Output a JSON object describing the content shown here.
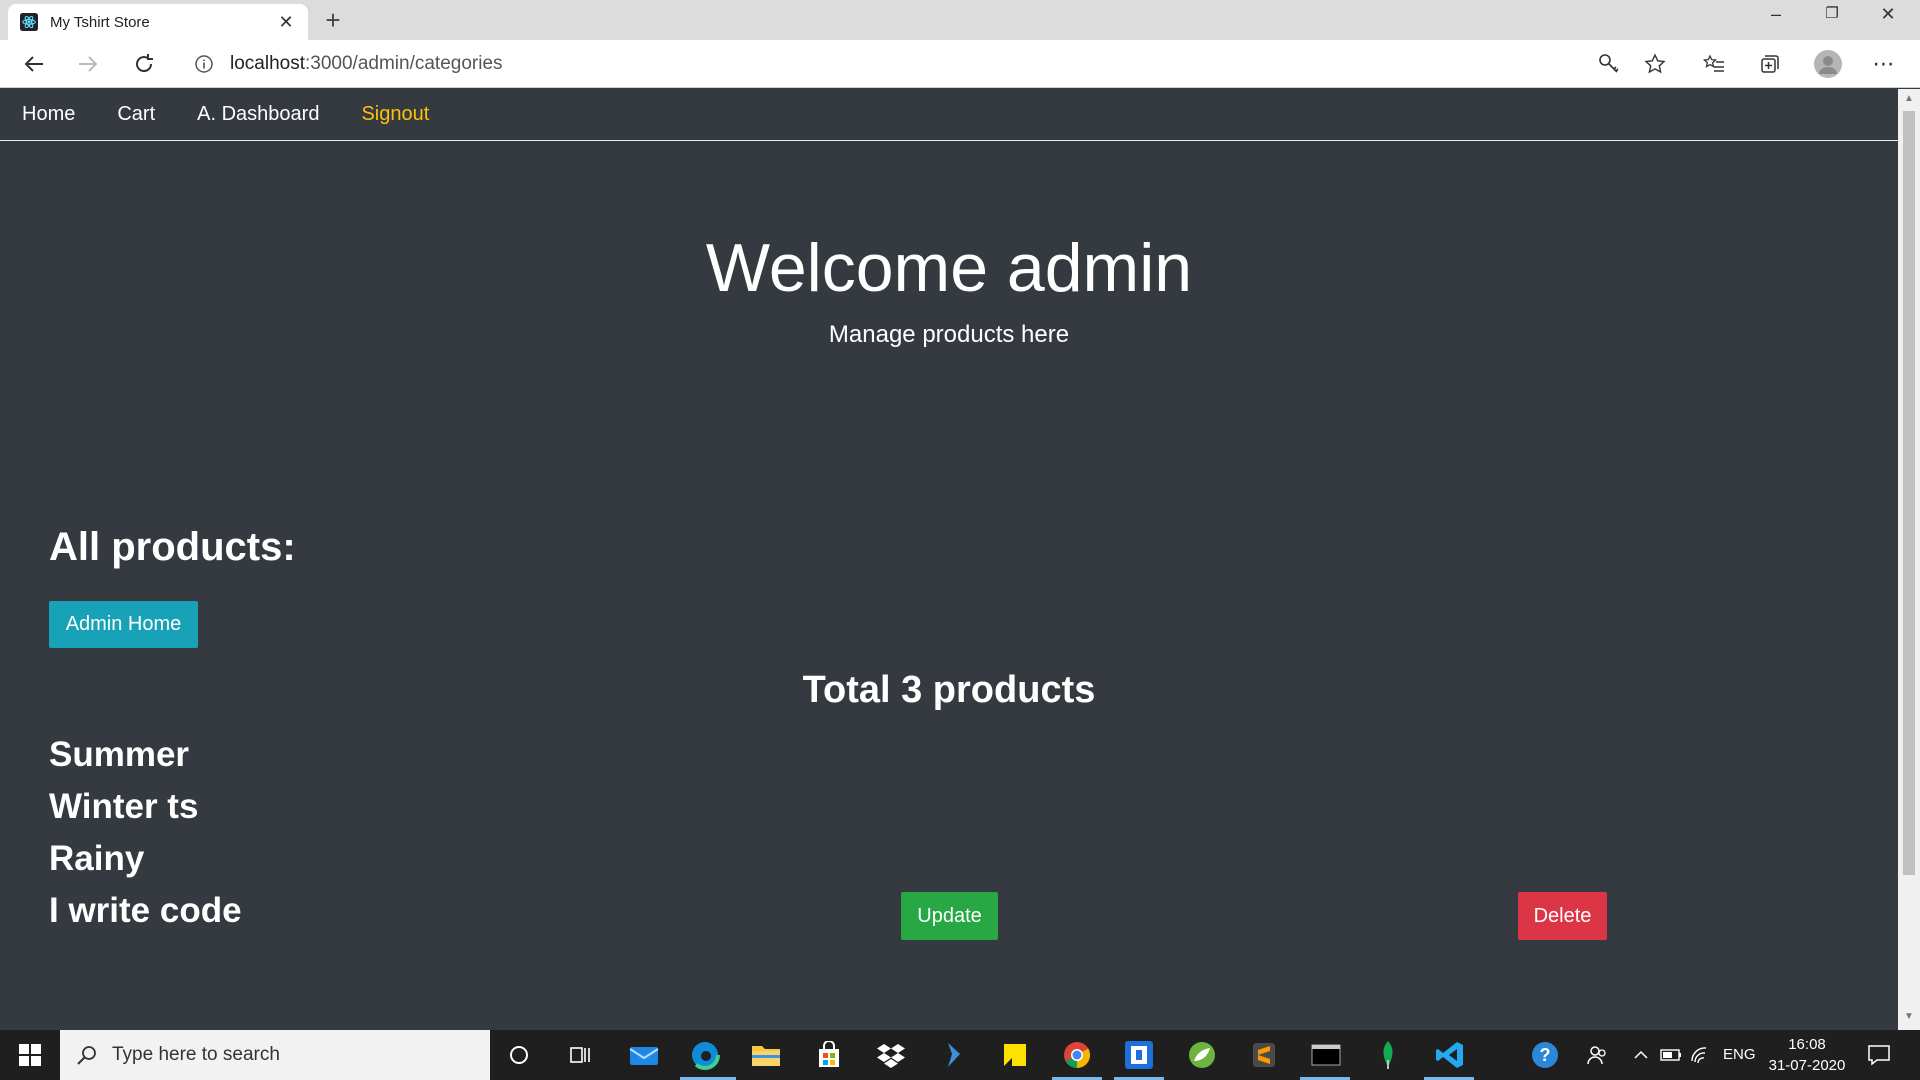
{
  "browser": {
    "tab_title": "My Tshirt Store",
    "tab_close": "✕",
    "new_tab": "+",
    "url_host": "localhost",
    "url_path": ":3000/admin/categories",
    "window_controls": [
      "–",
      "❐",
      "✕"
    ]
  },
  "navbar": {
    "items": [
      "Home",
      "Cart",
      "A. Dashboard",
      "Signout"
    ]
  },
  "jumbotron": {
    "title": "Welcome admin",
    "subtitle": "Manage products here"
  },
  "main": {
    "section_title": "All products:",
    "admin_home_label": "Admin Home",
    "total_label": "Total 3 products",
    "categories": [
      "Summer",
      "Winter ts",
      "Rainy",
      "I write code"
    ],
    "update_label": "Update",
    "delete_label": "Delete"
  },
  "taskbar": {
    "search_placeholder": "Type here to search",
    "language": "ENG",
    "time": "16:08",
    "date": "31-07-2020"
  },
  "colors": {
    "page_bg": "#343a40",
    "signout": "#ffc107",
    "info_btn": "#17a2b8",
    "success": "#28a745",
    "danger": "#dc3545"
  }
}
